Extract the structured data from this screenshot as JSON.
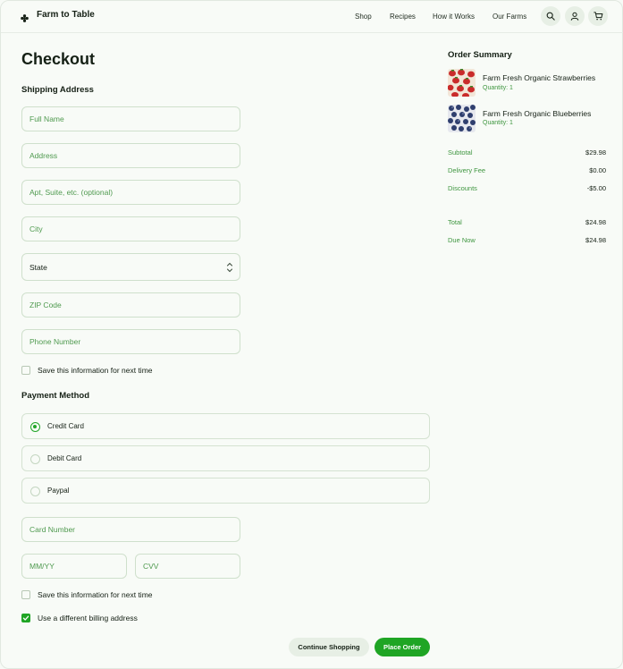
{
  "brand": {
    "name": "Farm to Table"
  },
  "nav": {
    "shop": "Shop",
    "recipes": "Recipes",
    "how_it_works": "How it Works",
    "our_farms": "Our Farms"
  },
  "page": {
    "title": "Checkout"
  },
  "shipping": {
    "title": "Shipping Address",
    "full_name": "Full Name",
    "address": "Address",
    "apt": "Apt, Suite, etc. (optional)",
    "city": "City",
    "state": "State",
    "zip": "ZIP Code",
    "phone": "Phone Number",
    "save_info": "Save this information for next time"
  },
  "payment": {
    "title": "Payment Method",
    "options": [
      "Credit Card",
      "Debit Card",
      "Paypal"
    ],
    "selected": "Credit Card",
    "card_number": "Card Number",
    "expiry": "MM/YY",
    "cvv": "CVV",
    "save_info": "Save this information for next time",
    "different_billing": "Use a different billing address"
  },
  "buttons": {
    "continue": "Continue Shopping",
    "place_order": "Place Order"
  },
  "summary": {
    "title": "Order Summary",
    "items": [
      {
        "name": "Farm Fresh Organic Strawberries",
        "quantity": "Quantity: 1",
        "icon": "strawberries-image"
      },
      {
        "name": "Farm Fresh Organic Blueberries",
        "quantity": "Quantity: 1",
        "icon": "blueberries-image"
      }
    ],
    "subtotal_label": "Subtotal",
    "subtotal": "$29.98",
    "delivery_label": "Delivery Fee",
    "delivery": "$0.00",
    "discounts_label": "Discounts",
    "discounts": "-$5.00",
    "total_label": "Total",
    "total": "$24.98",
    "due_label": "Due Now",
    "due": "$24.98"
  },
  "colors": {
    "accent": "#1fa524",
    "muted_green": "#3f9640",
    "background": "#f8fbf7"
  }
}
